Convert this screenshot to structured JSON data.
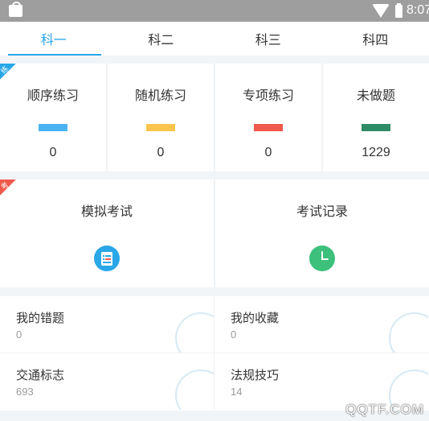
{
  "status_bar": {
    "time": "8:07",
    "icons": [
      "shopping-bag-icon",
      "wifi-icon",
      "battery-icon"
    ]
  },
  "tabs": [
    {
      "label": "科一",
      "active": true
    },
    {
      "label": "科二",
      "active": false
    },
    {
      "label": "科三",
      "active": false
    },
    {
      "label": "科四",
      "active": false
    }
  ],
  "practice": {
    "badge": "练",
    "badge_color": "#29a7e8",
    "items": [
      {
        "label": "顺序练习",
        "count": "0",
        "color": "#4ab3f4"
      },
      {
        "label": "随机练习",
        "count": "0",
        "color": "#fcc44c"
      },
      {
        "label": "专项练习",
        "count": "0",
        "color": "#f0594b"
      },
      {
        "label": "未做题",
        "count": "1229",
        "color": "#2e8b67"
      }
    ]
  },
  "exam": {
    "badge": "考",
    "badge_color": "#f0594b",
    "items": [
      {
        "label": "模拟考试",
        "icon": "exam-paper-icon",
        "color": "#29a7e8"
      },
      {
        "label": "考试记录",
        "icon": "clock-icon",
        "color": "#3cc07b"
      }
    ]
  },
  "lists": [
    {
      "label": "我的错题",
      "count": "0",
      "icon": "wrong-questions-icon"
    },
    {
      "label": "我的收藏",
      "count": "0",
      "icon": "favorites-icon"
    },
    {
      "label": "交通标志",
      "count": "693",
      "icon": "traffic-sign-icon"
    },
    {
      "label": "法规技巧",
      "count": "14",
      "icon": "regulations-tips-icon"
    }
  ],
  "watermark": "QQTF.COM"
}
